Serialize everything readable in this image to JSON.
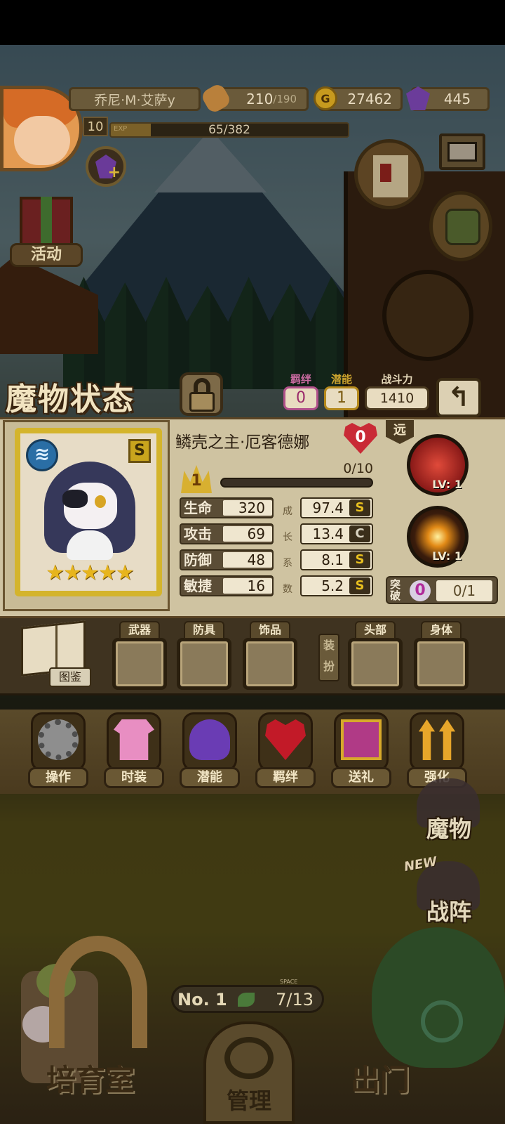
{
  "player": {
    "name": "乔尼·M·艾萨y",
    "level": "10",
    "exp_label": "EXP",
    "exp_text": "65/382",
    "exp_fraction": 0.17
  },
  "resources": {
    "stamina_current": "210",
    "stamina_max": "/190",
    "gold_symbol": "G",
    "gold": "27462",
    "gems": "445"
  },
  "left_menu": {
    "activity_label": "活动"
  },
  "header": {
    "title": "魔物状态",
    "bond_title": "羁绊",
    "bond_value": "0",
    "potential_title": "潜能",
    "potential_value": "1",
    "power_title": "战斗力",
    "power_value": "1410",
    "back_symbol": "↰"
  },
  "monster": {
    "element_symbol": "≋",
    "rank": "S",
    "stars": "★★★★★",
    "star_count": 5,
    "name": "鳞壳之主·厄客德娜",
    "affection": "0",
    "level": "1",
    "level_progress": "0/10",
    "growth_caption": [
      "成",
      "长",
      "系",
      "数"
    ],
    "stats": [
      {
        "label": "生命",
        "value": "320",
        "growth": "97.4",
        "grade": "S"
      },
      {
        "label": "攻击",
        "value": "69",
        "growth": "13.4",
        "grade": "C"
      },
      {
        "label": "防御",
        "value": "48",
        "growth": "8.1",
        "grade": "S"
      },
      {
        "label": "敏捷",
        "value": "16",
        "growth": "5.2",
        "grade": "S"
      }
    ]
  },
  "skills": {
    "range": "远",
    "skill1_level": "LV: 1",
    "skill2_level": "LV: 1",
    "breakthrough_label": "突破",
    "breakthrough_value": "0",
    "breakthrough_progress": "0/1"
  },
  "equipment": {
    "codex_label": "图鉴",
    "weapon": "武器",
    "armor": "防具",
    "accessory": "饰品",
    "dress_tag": "装扮",
    "head": "头部",
    "body": "身体"
  },
  "actions": {
    "operate": "操作",
    "fashion": "时装",
    "potential": "潜能",
    "bond": "羁绊",
    "gift": "送礼",
    "enhance": "强化"
  },
  "side_menu": {
    "monsters": "魔物",
    "new_tag": "NEW",
    "formation": "战阵"
  },
  "bottom": {
    "nursery": "培育室",
    "manage": "管理",
    "exit": "出门",
    "rank_label": "No. 1",
    "space_caption": "SPACE",
    "space_value": "7/13"
  }
}
